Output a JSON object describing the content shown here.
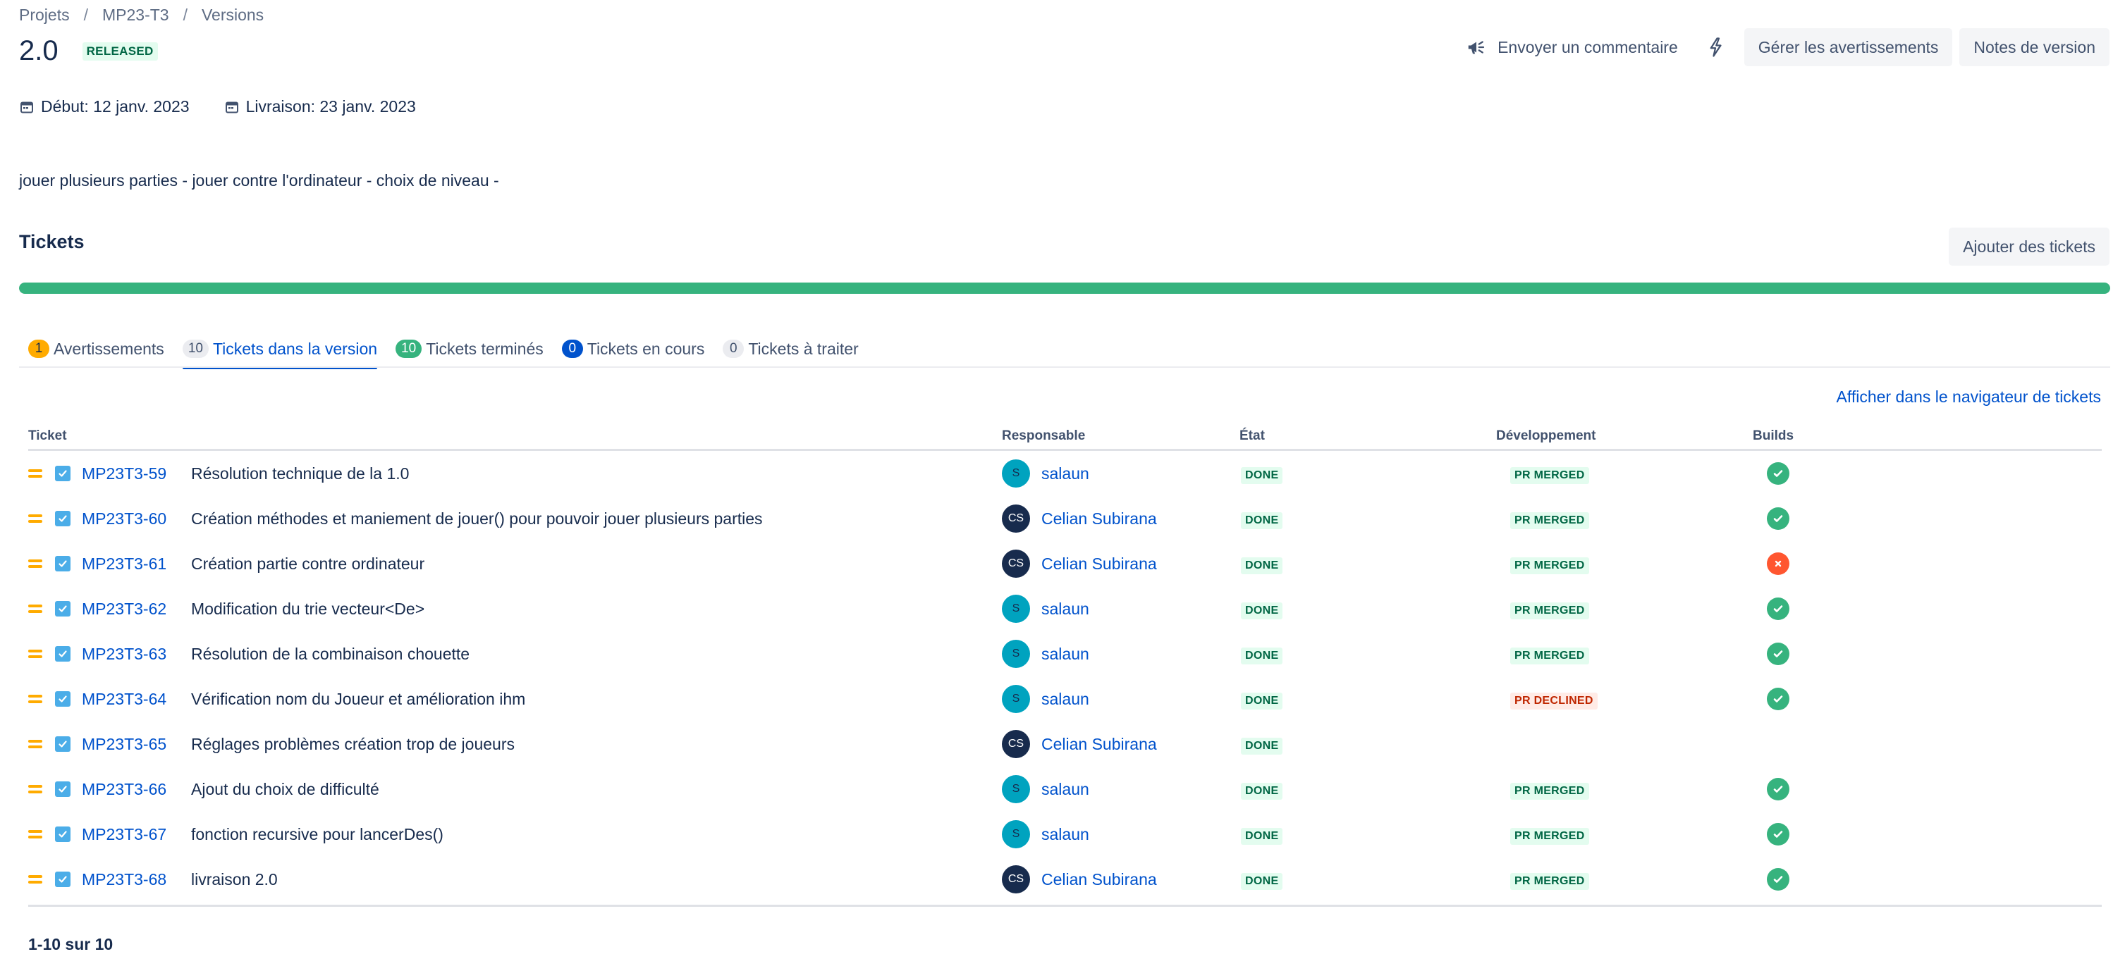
{
  "breadcrumbs": [
    "Projets",
    "MP23-T3",
    "Versions"
  ],
  "version": {
    "title": "2.0",
    "status": "RELEASED",
    "start_label": "Début: 12 janv. 2023",
    "release_label": "Livraison: 23 janv. 2023",
    "description": "jouer plusieurs parties - jouer contre l'ordinateur - choix de niveau -"
  },
  "top_actions": {
    "feedback_label": "Envoyer un commentaire",
    "manage_warnings_label": "Gérer les avertissements",
    "release_notes_label": "Notes de version"
  },
  "tickets_section": {
    "heading": "Tickets",
    "add_label": "Ajouter des tickets",
    "progress": 1.0,
    "navigator_link": "Afficher dans le navigateur de tickets"
  },
  "tabs": [
    {
      "count": "1",
      "label": "Avertissements",
      "badge_color": "amber"
    },
    {
      "count": "10",
      "label": "Tickets dans la version",
      "badge_color": "grey",
      "selected": true
    },
    {
      "count": "10",
      "label": "Tickets terminés",
      "badge_color": "green"
    },
    {
      "count": "0",
      "label": "Tickets en cours",
      "badge_color": "blue"
    },
    {
      "count": "0",
      "label": "Tickets à traiter",
      "badge_color": "grey"
    }
  ],
  "table": {
    "headers": {
      "ticket": "Ticket",
      "assignee": "Responsable",
      "state": "État",
      "development": "Développement",
      "builds": "Builds"
    },
    "rows": [
      {
        "key": "MP23T3-59",
        "summary": "Résolution technique de la 1.0",
        "assignee": "salaun",
        "avatar": "S",
        "avatar_color": "cyan",
        "state": "DONE",
        "dev": "PR MERGED",
        "dev_status": "merged",
        "build": "ok"
      },
      {
        "key": "MP23T3-60",
        "summary": "Création méthodes et maniement de jouer() pour pouvoir jouer plusieurs parties",
        "assignee": "Celian Subirana",
        "avatar": "CS",
        "avatar_color": "dark",
        "state": "DONE",
        "dev": "PR MERGED",
        "dev_status": "merged",
        "build": "ok"
      },
      {
        "key": "MP23T3-61",
        "summary": "Création partie contre ordinateur",
        "assignee": "Celian Subirana",
        "avatar": "CS",
        "avatar_color": "dark",
        "state": "DONE",
        "dev": "PR MERGED",
        "dev_status": "merged",
        "build": "fail"
      },
      {
        "key": "MP23T3-62",
        "summary": "Modification du trie vecteur<De>",
        "assignee": "salaun",
        "avatar": "S",
        "avatar_color": "cyan",
        "state": "DONE",
        "dev": "PR MERGED",
        "dev_status": "merged",
        "build": "ok"
      },
      {
        "key": "MP23T3-63",
        "summary": "Résolution de la combinaison chouette",
        "assignee": "salaun",
        "avatar": "S",
        "avatar_color": "cyan",
        "state": "DONE",
        "dev": "PR MERGED",
        "dev_status": "merged",
        "build": "ok"
      },
      {
        "key": "MP23T3-64",
        "summary": "Vérification nom du Joueur et amélioration ihm",
        "assignee": "salaun",
        "avatar": "S",
        "avatar_color": "cyan",
        "state": "DONE",
        "dev": "PR DECLINED",
        "dev_status": "declined",
        "build": "ok"
      },
      {
        "key": "MP23T3-65",
        "summary": "Réglages problèmes création trop de joueurs",
        "assignee": "Celian Subirana",
        "avatar": "CS",
        "avatar_color": "dark",
        "state": "DONE",
        "dev": "",
        "dev_status": "none",
        "build": "none"
      },
      {
        "key": "MP23T3-66",
        "summary": "Ajout du choix de difficulté",
        "assignee": "salaun",
        "avatar": "S",
        "avatar_color": "cyan",
        "state": "DONE",
        "dev": "PR MERGED",
        "dev_status": "merged",
        "build": "ok"
      },
      {
        "key": "MP23T3-67",
        "summary": "fonction recursive pour lancerDes()",
        "assignee": "salaun",
        "avatar": "S",
        "avatar_color": "cyan",
        "state": "DONE",
        "dev": "PR MERGED",
        "dev_status": "merged",
        "build": "ok"
      },
      {
        "key": "MP23T3-68",
        "summary": "livraison 2.0",
        "assignee": "Celian Subirana",
        "avatar": "CS",
        "avatar_color": "dark",
        "state": "DONE",
        "dev": "PR MERGED",
        "dev_status": "merged",
        "build": "ok"
      }
    ]
  },
  "pagination": "1-10 sur 10",
  "colors": {
    "link": "#0052cc",
    "success": "#36b37e",
    "danger": "#ff5630",
    "priority_medium": "#ffab00"
  },
  "icons": [
    "megaphone-icon",
    "lightning-icon",
    "calendar-icon",
    "medium-priority-icon",
    "task-checkbox-icon",
    "build-success-icon",
    "build-failed-icon"
  ]
}
